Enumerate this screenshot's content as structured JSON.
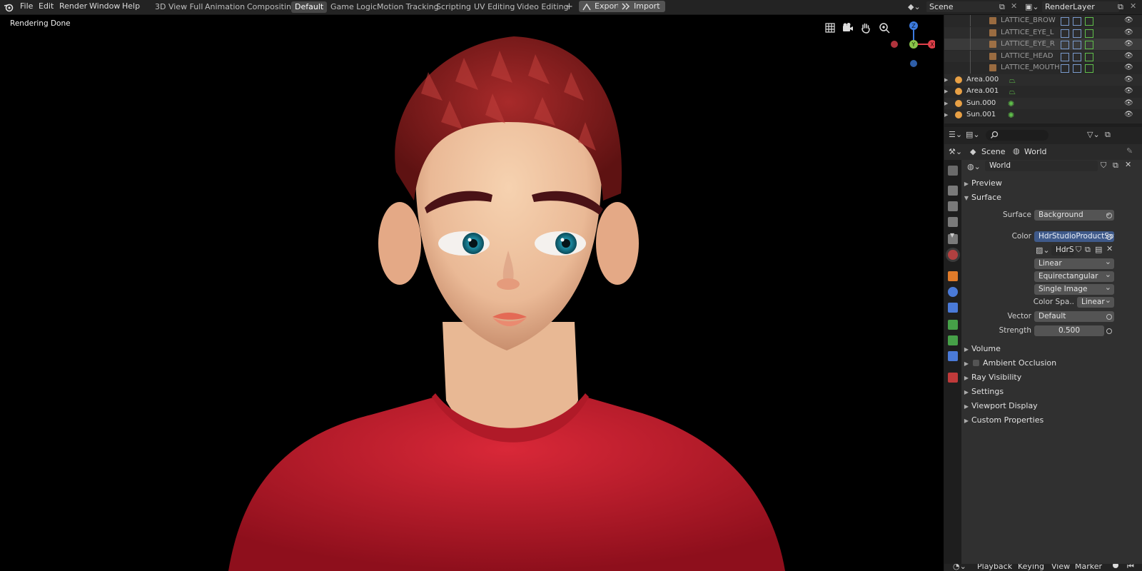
{
  "menu": [
    "File",
    "Edit",
    "Render",
    "Window",
    "Help"
  ],
  "workspaces": [
    {
      "label": "3D View Full",
      "active": false
    },
    {
      "label": "Animation",
      "active": false
    },
    {
      "label": "Compositing",
      "active": false
    },
    {
      "label": "Default",
      "active": true
    },
    {
      "label": "Game Logic",
      "active": false
    },
    {
      "label": "Motion Tracking",
      "active": false
    },
    {
      "label": "Scripting",
      "active": false
    },
    {
      "label": "UV Editing",
      "active": false
    },
    {
      "label": "Video Editing",
      "active": false
    }
  ],
  "add_workspace_label": "+",
  "export_label": "Export",
  "import_label": "Import",
  "scene_name": "Scene",
  "render_layer": "RenderLayer",
  "viewport": {
    "status": "Rendering Done",
    "gizmo": {
      "z": "Z",
      "y": "Y",
      "x": "X"
    }
  },
  "outliner": {
    "rows": [
      {
        "name": "LATTICE_BROW",
        "type": "lattice"
      },
      {
        "name": "LATTICE_EYE_L",
        "type": "lattice"
      },
      {
        "name": "LATTICE_EYE_R",
        "type": "lattice"
      },
      {
        "name": "LATTICE_HEAD",
        "type": "lattice"
      },
      {
        "name": "LATTICE_MOUTH",
        "type": "lattice"
      },
      {
        "name": "Area.000",
        "type": "light"
      },
      {
        "name": "Area.001",
        "type": "light"
      },
      {
        "name": "Sun.000",
        "type": "sun"
      },
      {
        "name": "Sun.001",
        "type": "sun"
      }
    ]
  },
  "properties": {
    "breadcrumb_scene": "Scene",
    "breadcrumb_world": "World",
    "world_name": "World",
    "panels": {
      "preview": "Preview",
      "surface": "Surface",
      "volume": "Volume",
      "ambient_occlusion": "Ambient Occlusion",
      "ray_visibility": "Ray Visibility",
      "settings": "Settings",
      "viewport_display": "Viewport Display",
      "custom_properties": "Custom Properties"
    },
    "surface_label": "Surface",
    "surface_value": "Background",
    "color_label": "Color",
    "color_value": "HdrStudioProductSof...",
    "image_name": "HdrS",
    "interpolation": "Linear",
    "projection": "Equirectangular",
    "source": "Single Image",
    "color_space_label": "Color Spa..",
    "color_space_value": "Linear",
    "vector_label": "Vector",
    "vector_value": "Default",
    "strength_label": "Strength",
    "strength_value": "0.500"
  },
  "timeline": {
    "items": [
      "Playback",
      "Keying",
      "View",
      "Marker"
    ]
  },
  "colors": {
    "accent_blue": "#3f5a8a",
    "active_tab": "#474747",
    "lattice_icon": "#c9874a",
    "light_icon": "#e8a045",
    "data_green": "#5fbf4a"
  }
}
